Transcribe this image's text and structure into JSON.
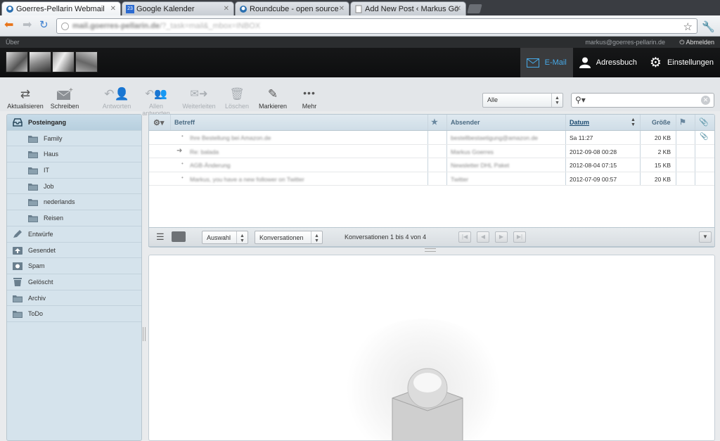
{
  "browser": {
    "tabs": [
      {
        "title": "Goerres-Pellarin Webmail",
        "active": true
      },
      {
        "title": "Google Kalender",
        "badge": "23",
        "active": false
      },
      {
        "title": "Roundcube - open source",
        "active": false
      },
      {
        "title": "Add New Post ‹ Markus Gö",
        "active": false
      }
    ],
    "url_host": "mail.goerres-pellarin.de",
    "url_path": "/?_task=mail&_mbox=INBOX"
  },
  "topline": {
    "about": "Über",
    "user": "markus@goerres-pellarin.de",
    "logout": "Abmelden"
  },
  "topnav": {
    "email": "E-Mail",
    "addressbook": "Adressbuch",
    "settings": "Einstellungen"
  },
  "toolbar": {
    "refresh": "Aktualisieren",
    "compose": "Schreiben",
    "reply": "Antworten",
    "reply_all": "Allen antworten",
    "forward": "Weiterleiten",
    "delete": "Löschen",
    "mark": "Markieren",
    "more": "Mehr",
    "filter_value": "Alle"
  },
  "folders": [
    {
      "name": "Posteingang",
      "icon": "inbox-icon",
      "selected": true,
      "sub": false
    },
    {
      "name": "Family",
      "icon": "folder-icon",
      "sub": true
    },
    {
      "name": "Haus",
      "icon": "folder-icon",
      "sub": true
    },
    {
      "name": "IT",
      "icon": "folder-icon",
      "sub": true
    },
    {
      "name": "Job",
      "icon": "folder-icon",
      "sub": true
    },
    {
      "name": "nederlands",
      "icon": "folder-icon",
      "sub": true
    },
    {
      "name": "Reisen",
      "icon": "folder-icon",
      "sub": true
    },
    {
      "name": "Entwürfe",
      "icon": "pencil-icon",
      "sub": false
    },
    {
      "name": "Gesendet",
      "icon": "sent-icon",
      "sub": false
    },
    {
      "name": "Spam",
      "icon": "spam-icon",
      "sub": false
    },
    {
      "name": "Gelöscht",
      "icon": "trash-icon",
      "sub": false
    },
    {
      "name": "Archiv",
      "icon": "archive-icon",
      "sub": false
    },
    {
      "name": "ToDo",
      "icon": "folder-icon",
      "sub": false
    }
  ],
  "messagelist": {
    "columns": {
      "subject": "Betreff",
      "sender": "Absender",
      "date": "Datum",
      "size": "Größe"
    },
    "rows": [
      {
        "subject": "Ihre Bestellung bei Amazon.de",
        "sender": "bestellbestaetigung@amazon.de",
        "date": "Sa 11:27",
        "size": "20 KB",
        "attachment": true
      },
      {
        "subject": "Re: balada",
        "sender": "Markus Goerres",
        "date": "2012-09-08 00:28",
        "size": "2 KB",
        "attachment": false
      },
      {
        "subject": "AGB-Änderung",
        "sender": "Newsletter DHL Paket",
        "date": "2012-08-04 07:15",
        "size": "15 KB",
        "attachment": false
      },
      {
        "subject": "Markus, you have a new follower on Twitter",
        "sender": "Twitter",
        "date": "2012-07-09 00:57",
        "size": "20 KB",
        "attachment": false
      }
    ],
    "footer": {
      "select": "Auswahl",
      "threads": "Konversationen",
      "count": "Konversationen 1 bis 4 von 4"
    }
  }
}
